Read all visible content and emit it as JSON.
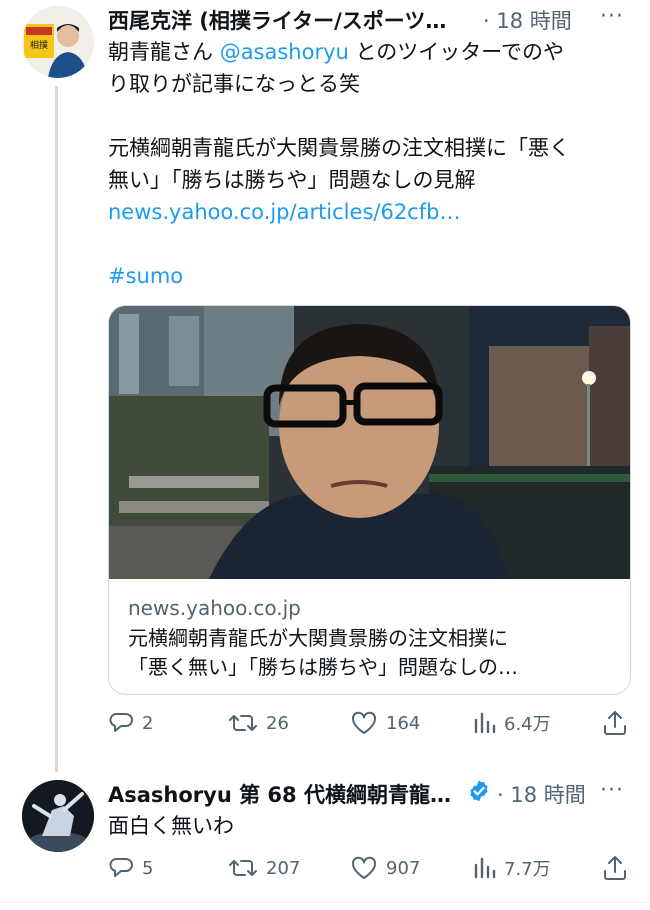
{
  "tweet1": {
    "author_name": "西尾克洋 (相撲ライター/スポーツ…",
    "time": "· 18 時間",
    "line1_prefix": "朝青龍さん ",
    "mention": "@asashoryu",
    "line1_suffix": " とのツイッターでのや",
    "line2": "り取りが記事になっとる笑",
    "line3": "元横綱朝青龍氏が大関貴景勝の注文相撲に「悪く",
    "line4": "無い」「勝ちは勝ちや」問題なしの見解",
    "link": "news.yahoo.co.jp/articles/62cfb…",
    "hashtag": "#sumo",
    "card": {
      "domain": "news.yahoo.co.jp",
      "title_line1": "元横綱朝青龍氏が大関貴景勝の注文相撲に",
      "title_line2": "「悪く無い」「勝ちは勝ちや」問題なしの…"
    },
    "stats": {
      "replies": "2",
      "retweets": "26",
      "likes": "164",
      "views": "6.4万"
    },
    "avatar_sign": "相撲"
  },
  "tweet2": {
    "author_name": "Asashoryu 第 68 代横綱朝青龍…",
    "time": "· 18 時間",
    "text": "面白く無いわ",
    "stats": {
      "replies": "5",
      "retweets": "207",
      "likes": "907",
      "views": "7.7万"
    }
  },
  "colors": {
    "accent": "#1d9bf0",
    "muted": "#536471",
    "line": "#cfd9de"
  }
}
